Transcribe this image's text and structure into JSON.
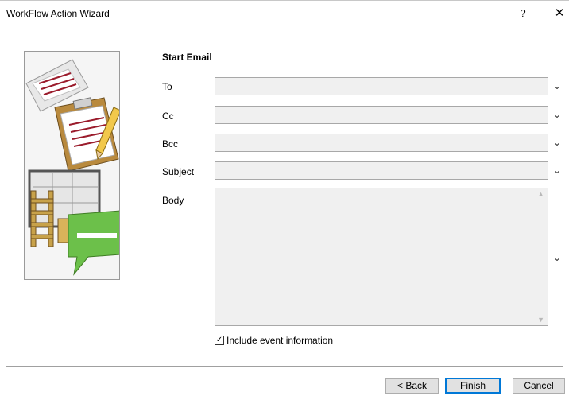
{
  "window": {
    "title": "WorkFlow Action Wizard",
    "help_label": "?",
    "close_label": "✕"
  },
  "form": {
    "section_title": "Start Email",
    "to_label": "To",
    "to_value": "",
    "cc_label": "Cc",
    "cc_value": "",
    "bcc_label": "Bcc",
    "bcc_value": "",
    "subject_label": "Subject",
    "subject_value": "",
    "body_label": "Body",
    "body_value": "",
    "include_event_label": "Include event information",
    "include_event_checked": true,
    "dropdown_glyph": "⌄"
  },
  "footer": {
    "back_label": "< Back",
    "finish_label": "Finish",
    "cancel_label": "Cancel"
  },
  "colors": {
    "accent": "#0078d7",
    "field_bg": "#f0f0f0",
    "illustration_green": "#6cc04a",
    "illustration_wood": "#c8a24a",
    "illustration_line_red": "#9b1c2c"
  },
  "icons": {
    "side_illustration": "workflow-email-illustration"
  }
}
